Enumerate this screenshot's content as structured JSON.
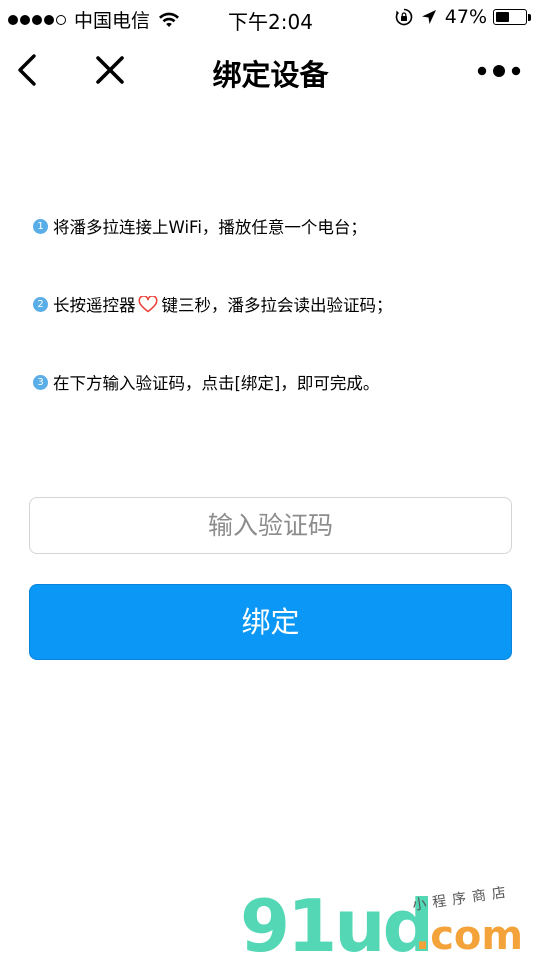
{
  "status_bar": {
    "carrier": "中国电信",
    "time": "下午2:04",
    "battery_percent": "47%",
    "battery_level": 0.47,
    "signal_bars_filled": 4,
    "signal_bars_total": 5
  },
  "nav": {
    "title": "绑定设备",
    "back_icon": "chevron-left",
    "close_icon": "close-x",
    "more_icon": "three-dots"
  },
  "steps": [
    {
      "num": "1",
      "text": "将潘多拉连接上WiFi，播放任意一个电台；"
    },
    {
      "num": "2",
      "text_before": "长按遥控器",
      "text_after": "键三秒，潘多拉会读出验证码；",
      "icon": "heart-outline"
    },
    {
      "num": "3",
      "text": "在下方输入验证码，点击[绑定]，即可完成。"
    }
  ],
  "form": {
    "code_placeholder": "输入验证码",
    "code_value": "",
    "bind_label": "绑定"
  },
  "watermark": {
    "logo_text": "91ud",
    "domain_text": ".com",
    "tagline": "小程序商店"
  },
  "colors": {
    "accent": "#0a97f5",
    "step_badge": "#5aaee8",
    "heart": "#e8453c",
    "watermark_green": "#53d7b5",
    "watermark_orange": "#f4a23a"
  }
}
